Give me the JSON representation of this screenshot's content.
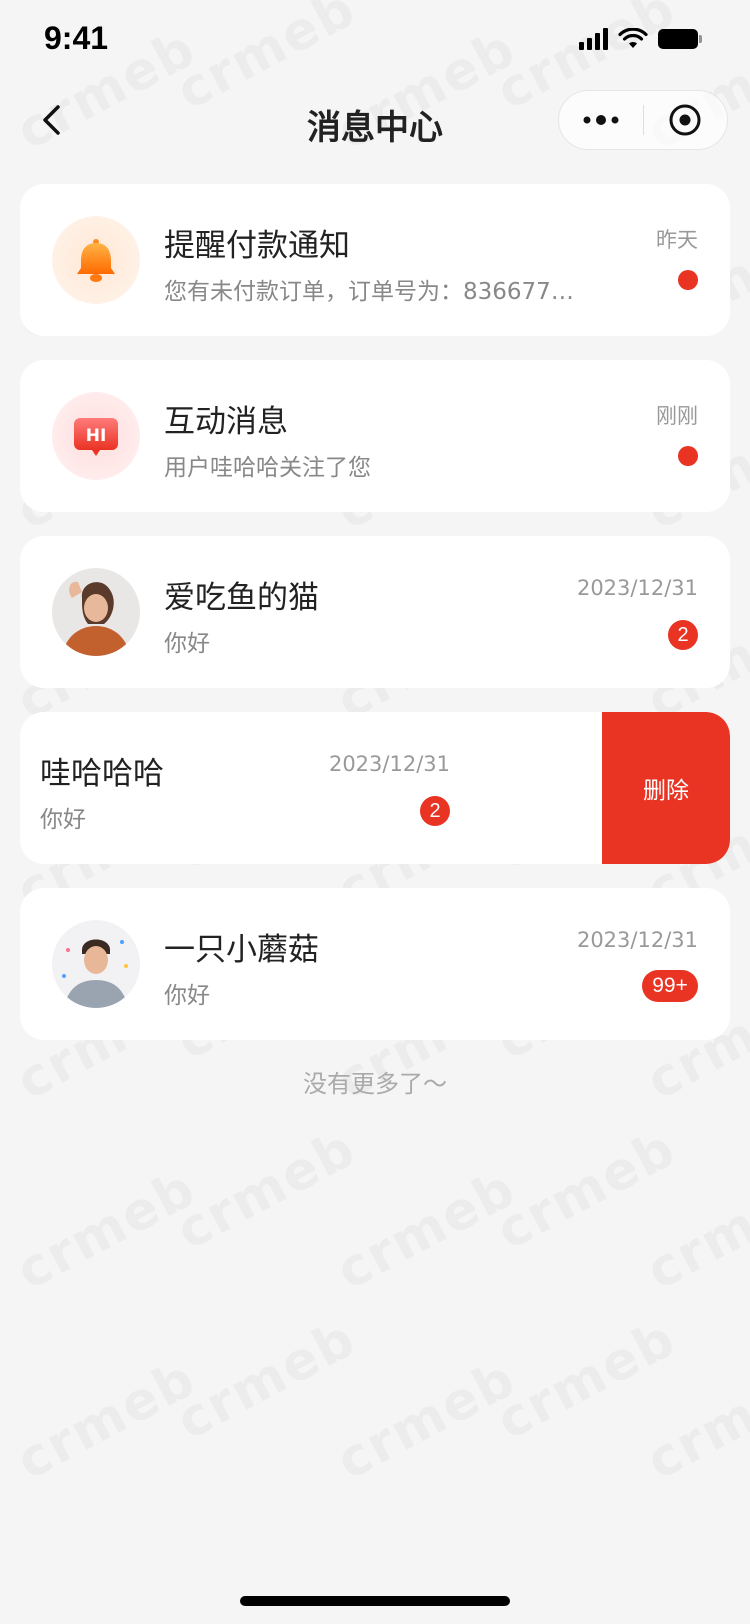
{
  "status_bar": {
    "time": "9:41"
  },
  "nav": {
    "title": "消息中心"
  },
  "messages": [
    {
      "title": "提醒付款通知",
      "preview": "您有未付款订单，订单号为：8366776...",
      "time": "昨天",
      "icon": "bell-icon",
      "unread_dot": true
    },
    {
      "title": "互动消息",
      "preview": "用户哇哈哈关注了您",
      "time": "刚刚",
      "icon": "hi-chat-icon",
      "unread_dot": true
    },
    {
      "title": "爱吃鱼的猫",
      "preview": "你好",
      "time": "2023/12/31",
      "icon": "avatar-woman",
      "badge": "2"
    },
    {
      "title": "哇哈哈哈",
      "preview": "你好",
      "time": "2023/12/31",
      "badge": "2",
      "action": "删除"
    },
    {
      "title": "一只小蘑菇",
      "preview": "你好",
      "time": "2023/12/31",
      "icon": "avatar-man",
      "badge": "99+"
    }
  ],
  "footer": {
    "no_more": "没有更多了～"
  },
  "colors": {
    "accent": "#e93323",
    "background": "#f5f5f5",
    "bell": "#ff8a1f"
  }
}
